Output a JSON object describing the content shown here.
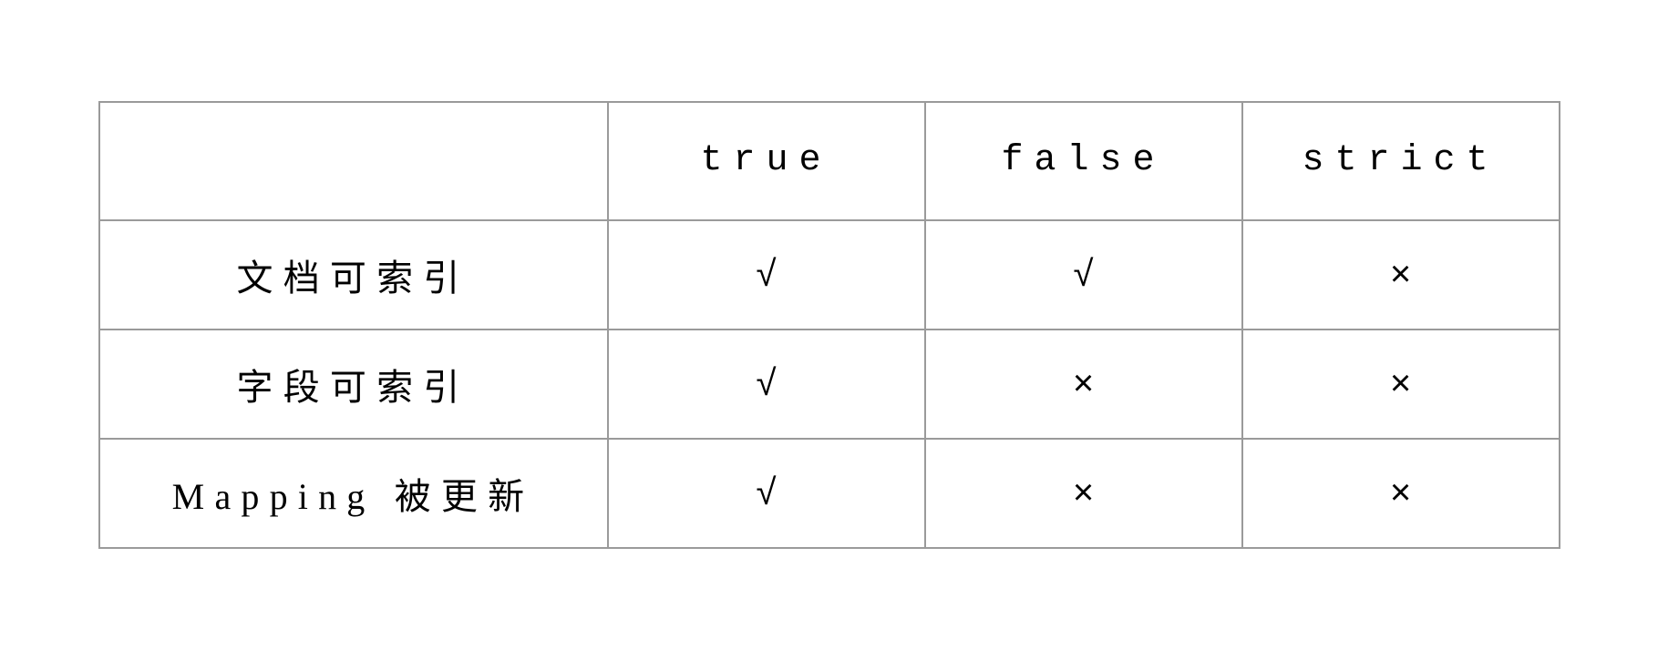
{
  "table": {
    "headers": [
      "",
      "true",
      "false",
      "strict"
    ],
    "rows": [
      {
        "label": "文档可索引",
        "cells": [
          "√",
          "√",
          "×"
        ]
      },
      {
        "label": "字段可索引",
        "cells": [
          "√",
          "×",
          "×"
        ]
      },
      {
        "label": "Mapping 被更新",
        "cells": [
          "√",
          "×",
          "×"
        ]
      }
    ]
  }
}
